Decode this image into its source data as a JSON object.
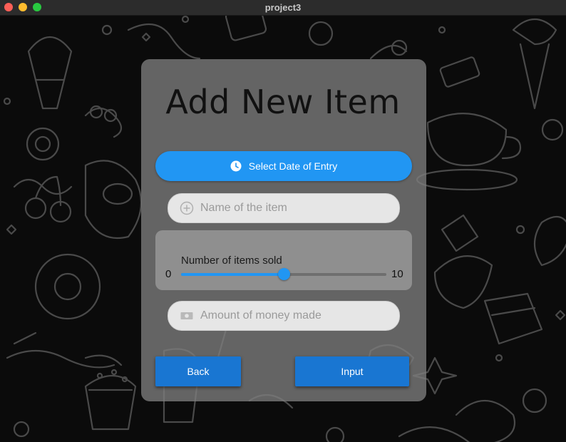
{
  "window": {
    "title": "project3"
  },
  "card": {
    "title": "Add New Item"
  },
  "date_button": {
    "label": "Select Date of Entry",
    "icon": "clock-icon"
  },
  "name_field": {
    "placeholder": "Name of the item",
    "value": "",
    "icon": "add-circle-icon"
  },
  "slider": {
    "label": "Number of items sold",
    "min": "0",
    "max": "10",
    "value": 5
  },
  "money_field": {
    "placeholder": "Amount of money made",
    "value": "",
    "icon": "money-icon"
  },
  "buttons": {
    "back_label": "Back",
    "input_label": "Input"
  },
  "colors": {
    "accent": "#2196f3",
    "button": "#1976d2",
    "card": "#7d7d7d",
    "field": "#e6e6e6"
  }
}
